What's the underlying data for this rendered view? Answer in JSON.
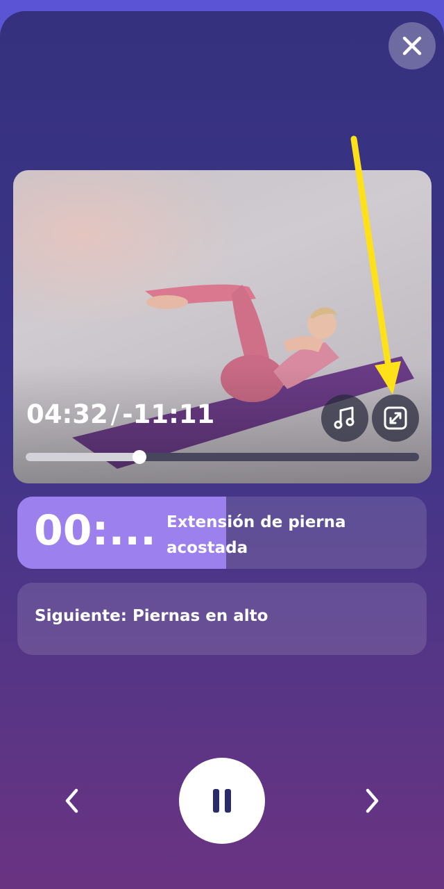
{
  "icons": {
    "close": "close-icon",
    "music": "music-note-icon",
    "fullscreen": "expand-icon",
    "previous": "chevron-left-icon",
    "pause": "pause-icon",
    "next": "chevron-right-icon"
  },
  "video": {
    "elapsed": "04:32",
    "separator": "/",
    "remaining": "-11:11",
    "progress": 0.29
  },
  "exercise": {
    "timer": "00:...",
    "name": "Extensión de pierna acostada",
    "progress": 0.51
  },
  "next": {
    "label": "Siguiente: Piernas en alto"
  },
  "colors": {
    "background_top": "#35317e",
    "background_bottom": "#6a3381",
    "accent": "#9b80ee",
    "annotation_arrow": "#ffe11a"
  }
}
